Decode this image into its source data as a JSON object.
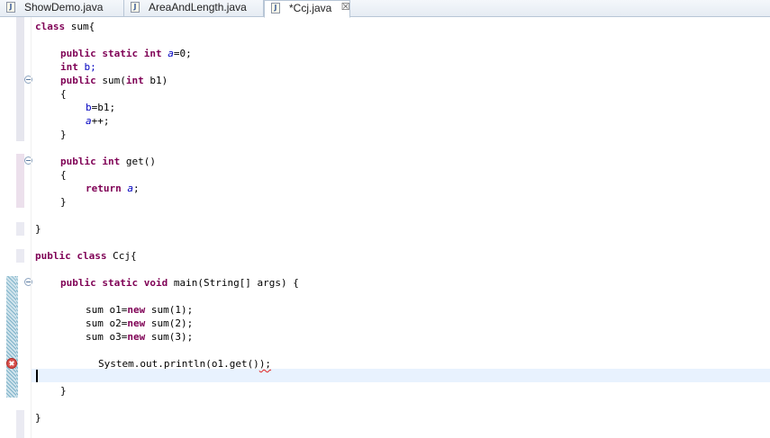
{
  "tabs": [
    {
      "label": "ShowDemo.java",
      "icon": "java-file-icon"
    },
    {
      "label": "AreaAndLength.java",
      "icon": "java-file-icon"
    },
    {
      "label": "*Ccj.java",
      "icon": "java-file-icon",
      "active": true,
      "close": "☒"
    }
  ],
  "java_icon_letter": "J",
  "colors": {
    "keyword": "#7f0055",
    "field": "#0000c0",
    "current_line": "#e8f2fe",
    "error": "#d9534f"
  },
  "code": {
    "l1": {
      "kw": "class",
      "rest": " sum{"
    },
    "l3": {
      "kw": "public static int",
      "sp": " ",
      "fld": "a",
      "rest": "=0;"
    },
    "l4": {
      "kw": "int",
      "rest": " b;"
    },
    "l5": {
      "kw": "public",
      "a": " sum(",
      "kw2": "int",
      "b": " b1)"
    },
    "l6": {
      "text": "{"
    },
    "l7": {
      "fld": "b",
      "rest": "=b1;"
    },
    "l8": {
      "fld": "a",
      "rest": "++;"
    },
    "l9": {
      "text": "}"
    },
    "l11": {
      "kw": "public int",
      "rest": " get()"
    },
    "l12": {
      "text": "{"
    },
    "l13": {
      "kw": "return",
      "sp": " ",
      "fld": "a",
      "rest": ";"
    },
    "l14": {
      "text": "}"
    },
    "l16": {
      "text": "}"
    },
    "l18": {
      "kw": "public class",
      "rest": " Ccj{"
    },
    "l20": {
      "kw": "public static void",
      "rest": " main(String[] args) {"
    },
    "l22": {
      "a": "sum o1=",
      "kw": "new",
      "b": " sum(1);"
    },
    "l23": {
      "a": "sum o2=",
      "kw": "new",
      "b": " sum(2);"
    },
    "l24": {
      "a": "sum o3=",
      "kw": "new",
      "b": " sum(3);"
    },
    "l26": {
      "a": "System.out.println(o1.get()",
      "err": ");"
    },
    "l28": {
      "text": "}"
    },
    "l30": {
      "text": "}"
    }
  }
}
